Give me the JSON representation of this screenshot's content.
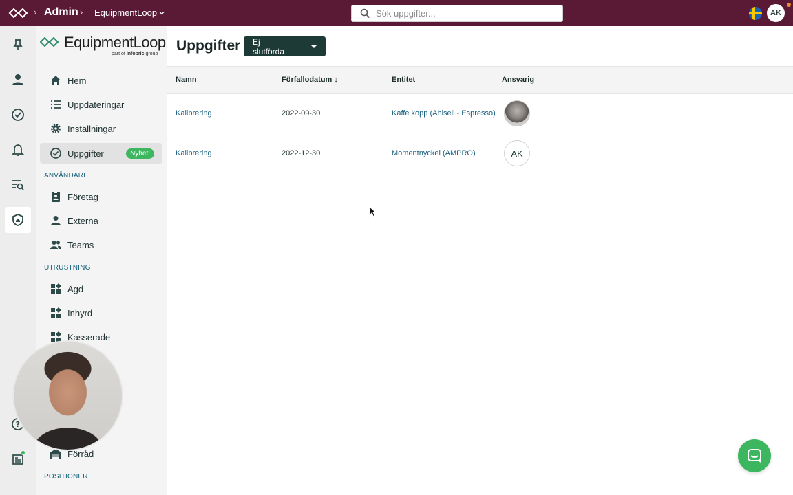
{
  "topbar": {
    "admin_label": "Admin",
    "org_label": "EquipmentLoop",
    "search_placeholder": "Sök uppgifter...",
    "user_initials": "AK",
    "bg_color": "#5a1a35"
  },
  "brand": {
    "name": "EquipmentLoop",
    "sub_prefix": "part of",
    "sub_bold": "infobric",
    "sub_suffix": "group"
  },
  "sidebar": {
    "main_items": [
      {
        "label": "Hem",
        "icon": "home-icon"
      },
      {
        "label": "Uppdateringar",
        "icon": "list-icon"
      },
      {
        "label": "Inställningar",
        "icon": "gear-icon"
      },
      {
        "label": "Uppgifter",
        "icon": "check-circle-icon",
        "badge": "Nyhet!",
        "active": true
      }
    ],
    "section_users": "ANVÄNDARE",
    "users_items": [
      {
        "label": "Företag",
        "icon": "company-badge-icon"
      },
      {
        "label": "Externa",
        "icon": "person-icon"
      },
      {
        "label": "Teams",
        "icon": "people-icon"
      }
    ],
    "section_equipment": "UTRUSTNING",
    "equipment_items": [
      {
        "label": "Ägd",
        "icon": "widgets-icon"
      },
      {
        "label": "Inhyrd",
        "icon": "widgets-icon"
      },
      {
        "label": "Kasserade",
        "icon": "widgets-icon"
      }
    ],
    "storage_item": {
      "label": "Förråd",
      "icon": "warehouse-icon"
    },
    "section_positions": "POSITIONER"
  },
  "main": {
    "title": "Uppgifter",
    "filter_label": "Ej slutförda",
    "columns": [
      "Namn",
      "Förfallodatum ↓",
      "Entitet",
      "Ansvarig"
    ],
    "rows": [
      {
        "name": "Kalibrering",
        "due": "2022-09-30",
        "entity": "Kaffe kopp (Ahlsell - Espresso)",
        "assignee": ""
      },
      {
        "name": "Kalibrering",
        "due": "2022-12-30",
        "entity": "Momentnyckel (AMPRO)",
        "assignee": "AK"
      }
    ]
  },
  "colors": {
    "accent_dark": "#1e3a36",
    "badge_green": "#3cb760",
    "link_blue": "#1a6080"
  }
}
